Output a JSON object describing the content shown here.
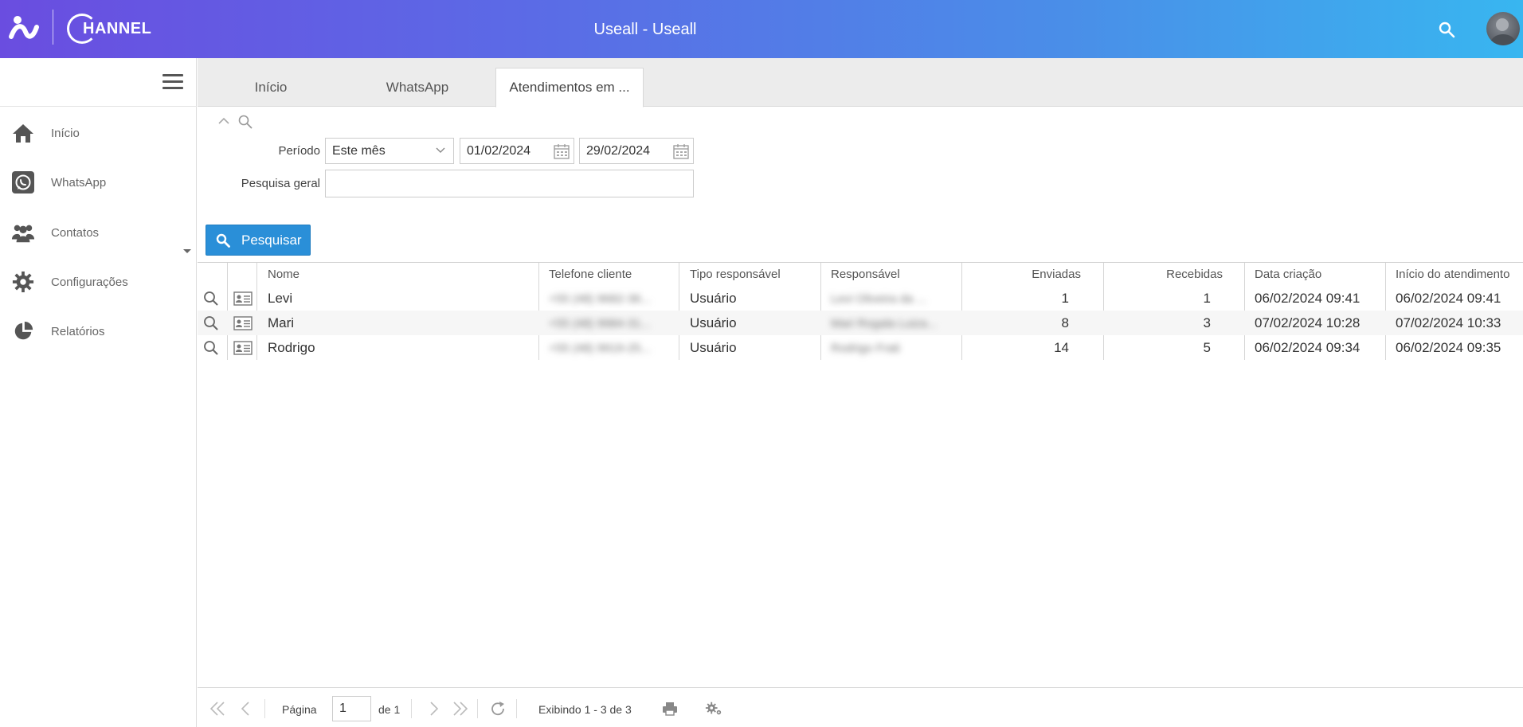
{
  "header": {
    "logo_word": "HANNEL",
    "title": "Useall - Useall"
  },
  "sidebar": {
    "items": [
      {
        "label": "Início",
        "icon": "home-icon"
      },
      {
        "label": "WhatsApp",
        "icon": "whatsapp-icon"
      },
      {
        "label": "Contatos",
        "icon": "contacts-icon"
      },
      {
        "label": "Configurações",
        "icon": "gear-icon"
      },
      {
        "label": "Relatórios",
        "icon": "pie-chart-icon"
      }
    ]
  },
  "tabs": [
    {
      "label": "Início",
      "active": false
    },
    {
      "label": "WhatsApp",
      "active": false
    },
    {
      "label": "Atendimentos em ...",
      "active": true
    }
  ],
  "filter": {
    "periodo_label": "Período",
    "periodo_value": "Este mês",
    "date_from": "01/02/2024",
    "date_to": "29/02/2024",
    "pesquisa_label": "Pesquisa geral",
    "pesquisa_value": "",
    "search_button": "Pesquisar"
  },
  "grid": {
    "columns": [
      "Nome",
      "Telefone cliente",
      "Tipo responsável",
      "Responsável",
      "Enviadas",
      "Recebidas",
      "Data criação",
      "Início do atendimento"
    ],
    "rows": [
      {
        "nome": "Levi",
        "telefone": "+55 (48) 9682-36...",
        "tipo": "Usuário",
        "responsavel": "Levi Oliveira da ...",
        "enviadas": "1",
        "recebidas": "1",
        "data_criacao": "06/02/2024 09:41",
        "inicio": "06/02/2024 09:41"
      },
      {
        "nome": "Mari",
        "telefone": "+55 (48) 9984-31...",
        "tipo": "Usuário",
        "responsavel": "Mari Rogala Luiza...",
        "enviadas": "8",
        "recebidas": "3",
        "data_criacao": "07/02/2024 10:28",
        "inicio": "07/02/2024 10:33"
      },
      {
        "nome": "Rodrigo",
        "telefone": "+55 (48) 9919-25...",
        "tipo": "Usuário",
        "responsavel": "Rodrigo Frati",
        "enviadas": "14",
        "recebidas": "5",
        "data_criacao": "06/02/2024 09:34",
        "inicio": "06/02/2024 09:35"
      }
    ]
  },
  "pager": {
    "page_label": "Página",
    "page_value": "1",
    "of_label": "de 1",
    "display_text": "Exibindo 1 - 3 de 3"
  },
  "colors": {
    "header_gradient_start": "#6a4de0",
    "header_gradient_end": "#38b6f0",
    "primary_button": "#2a8fd8"
  }
}
